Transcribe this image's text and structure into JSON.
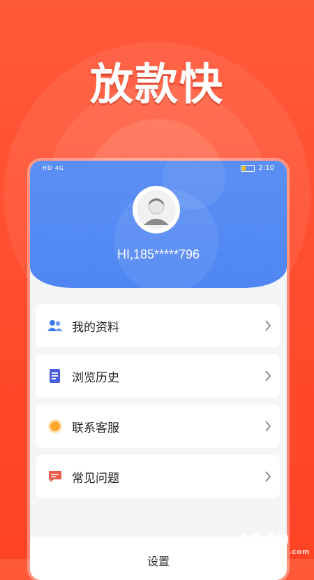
{
  "promo": {
    "headline": "放款快"
  },
  "statusbar": {
    "left_text": "HD 4G",
    "time": "2:10"
  },
  "profile": {
    "greeting": "HI,185*****796"
  },
  "menu": {
    "items": [
      {
        "label": "我的资料",
        "icon": "users-icon"
      },
      {
        "label": "浏览历史",
        "icon": "document-icon"
      },
      {
        "label": "联系客服",
        "icon": "support-icon"
      },
      {
        "label": "常见问题",
        "icon": "faq-icon"
      }
    ]
  },
  "bottom": {
    "label": "设置"
  },
  "watermark": {
    "text": "4040",
    "suffix": ".com"
  },
  "colors": {
    "accent_blue": "#4f86f3",
    "promo_red": "#ff4a2c"
  }
}
